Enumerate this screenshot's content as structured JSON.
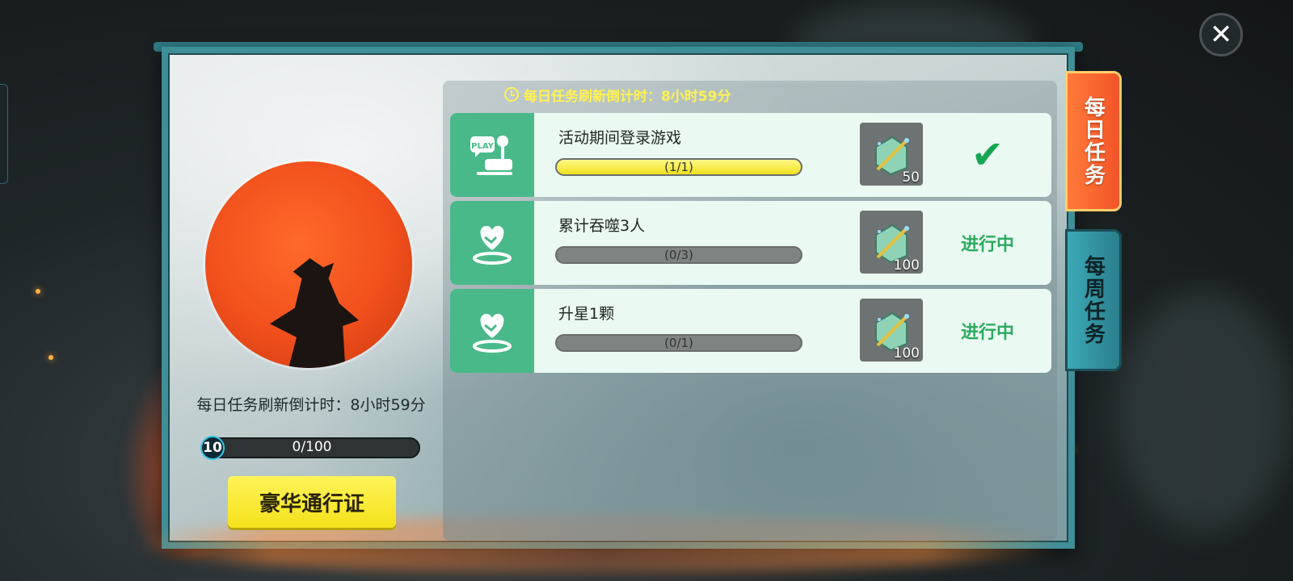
{
  "countdown_label": "每日任务刷新倒计时：8小时59分",
  "level": {
    "value": "10",
    "progress_text": "0/100",
    "progress": 0.0
  },
  "pass_button_label": "豪华通行证",
  "tabs": [
    {
      "label": "每日任务",
      "active": true
    },
    {
      "label": "每周任务",
      "active": false
    }
  ],
  "tasks": [
    {
      "title": "活动期间登录游戏",
      "progress_text": "(1/1)",
      "progress": 1.0,
      "reward_count": "50",
      "status": "done",
      "icon": "play-joystick-icon"
    },
    {
      "title": "累计吞噬3人",
      "progress_text": "(0/3)",
      "progress": 0.0,
      "reward_count": "100",
      "status_text": "进行中",
      "icon": "handshake-heart-icon"
    },
    {
      "title": "升星1颗",
      "progress_text": "(0/1)",
      "progress": 0.0,
      "reward_count": "100",
      "status_text": "进行中",
      "icon": "handshake-heart-icon"
    }
  ],
  "colors": {
    "accent_green": "#2daa5f",
    "progress_yellow": "#f0e11c",
    "tab_active": "#f35528",
    "tab_inactive": "#2a7f8c"
  }
}
